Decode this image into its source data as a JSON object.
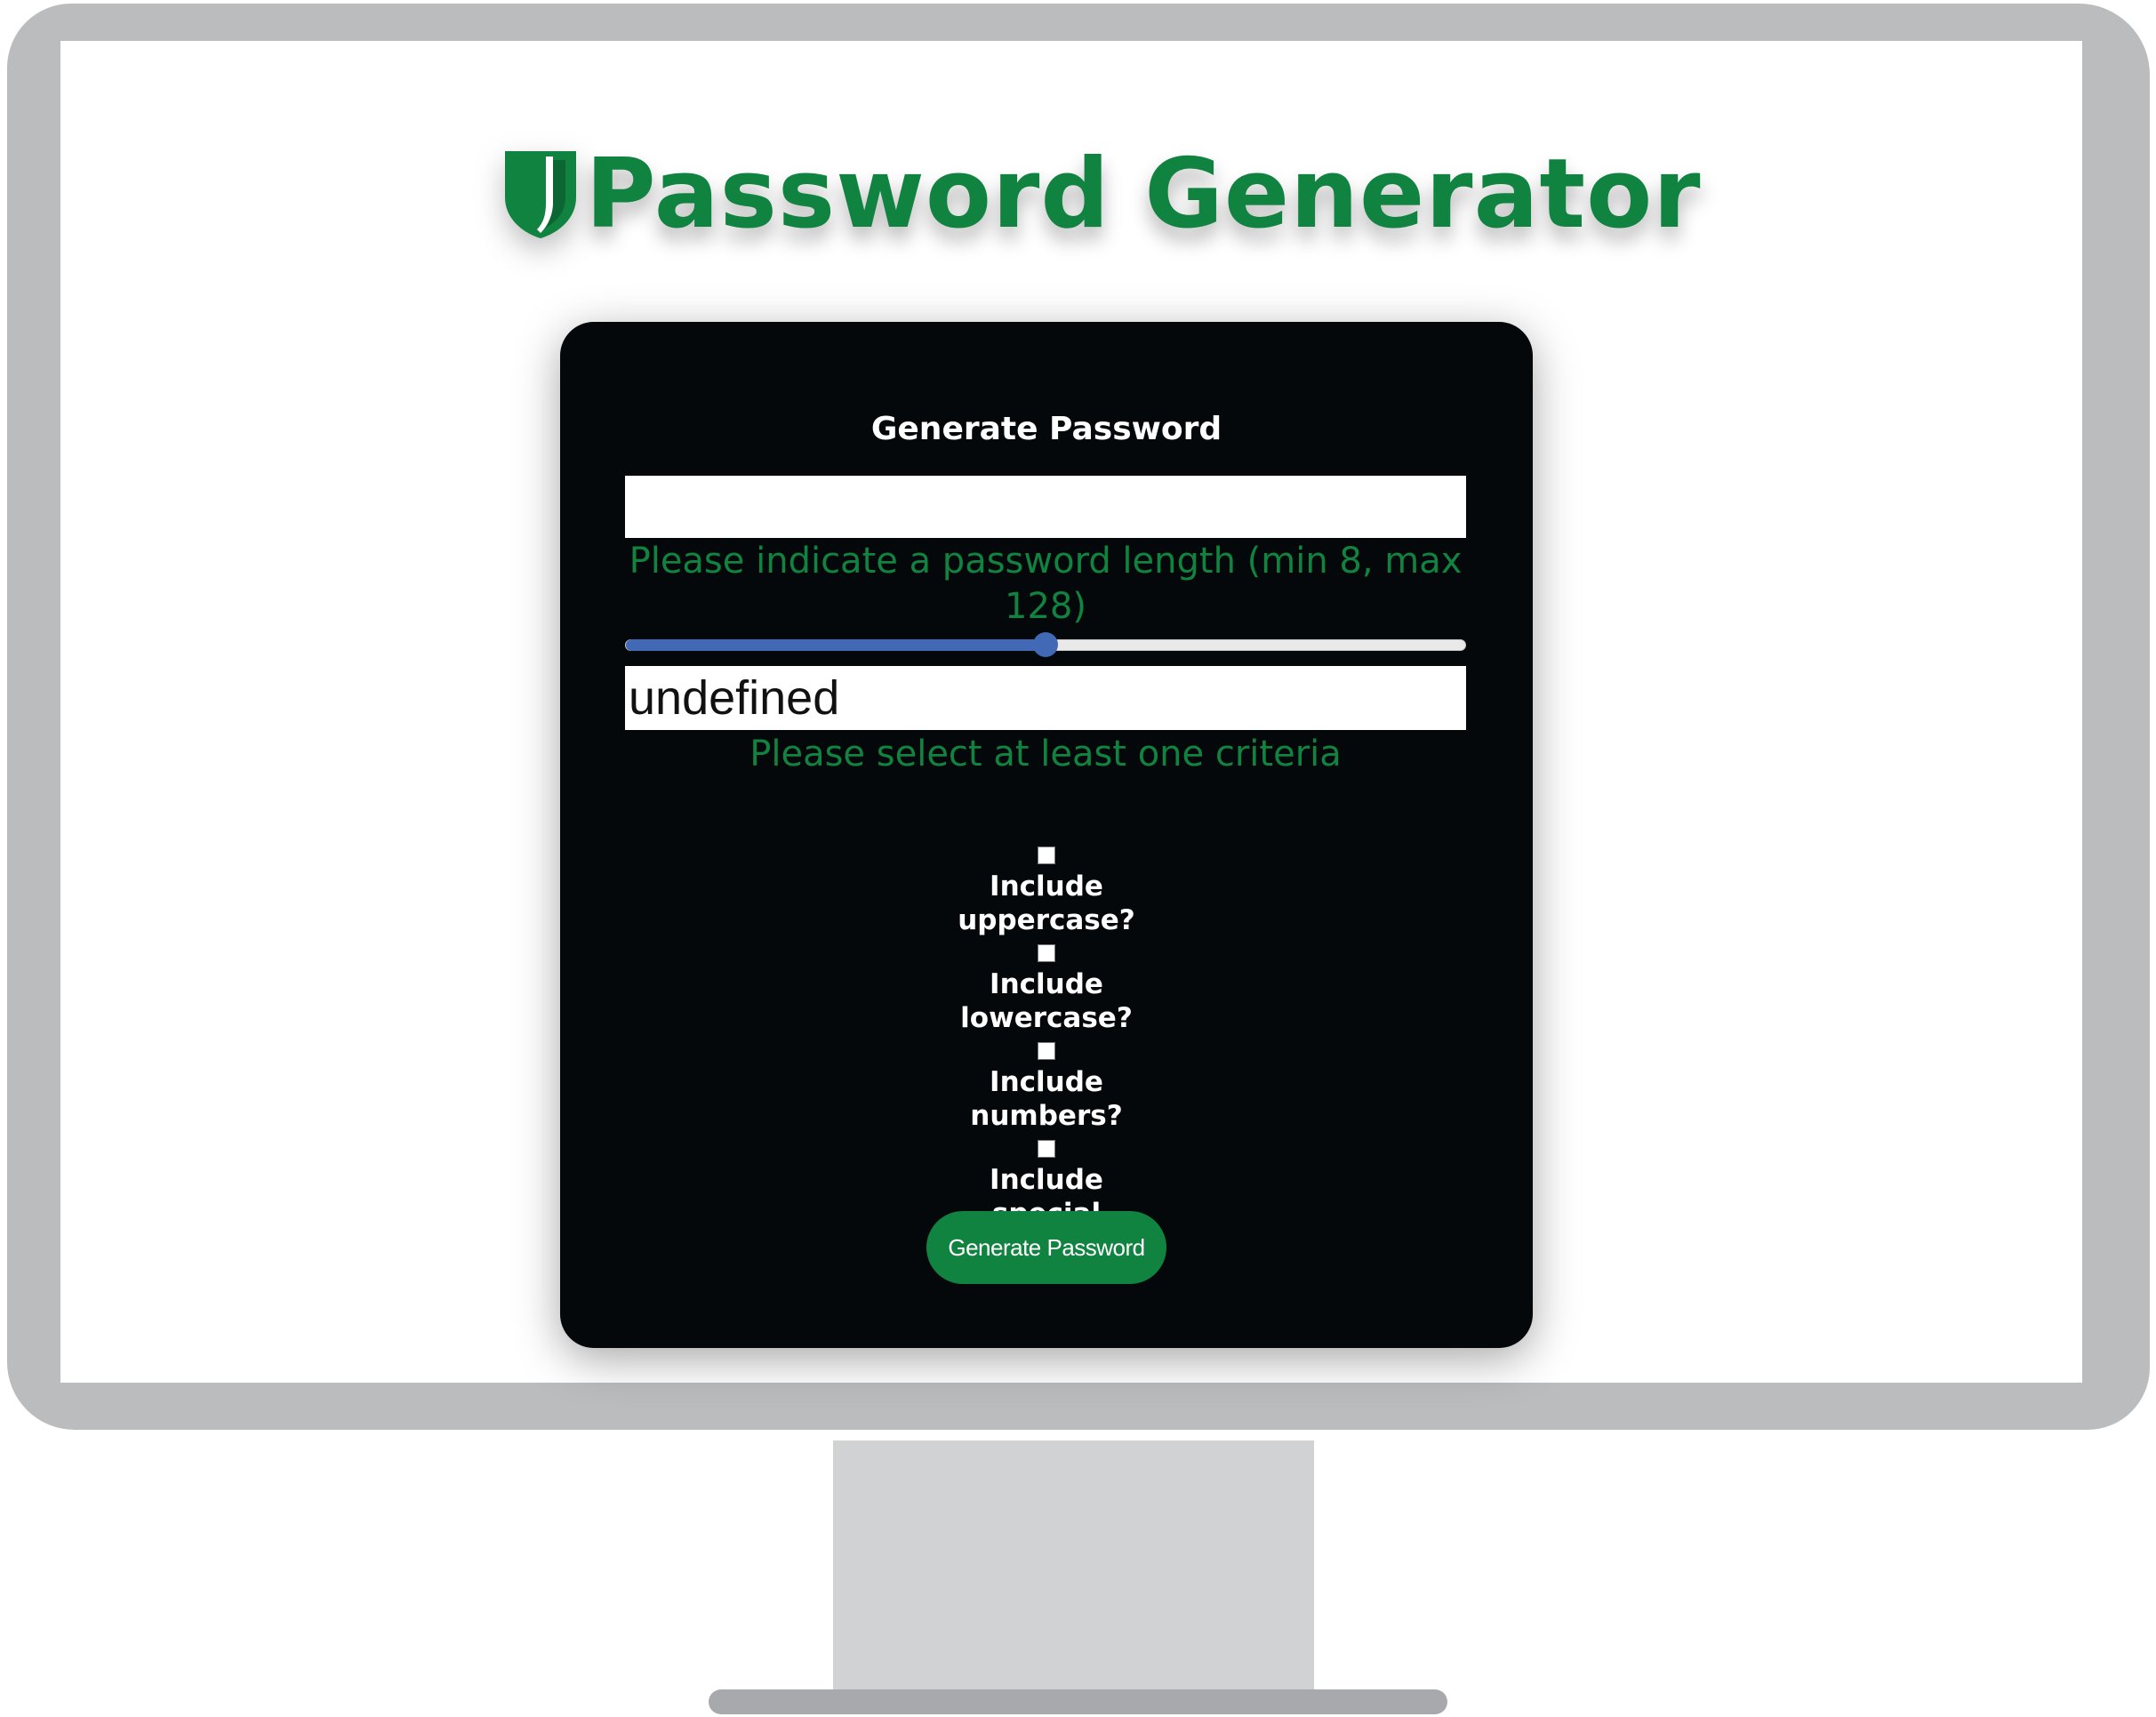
{
  "header": {
    "title": "Password Generator",
    "logo_icon": "shield-icon"
  },
  "card": {
    "title": "Generate Password",
    "password_output": "",
    "length_hint": "Please indicate a password length (min 8, max 128)",
    "length_slider": {
      "min": 8,
      "max": 128,
      "fill_fraction": 0.5
    },
    "length_value": "undefined",
    "criteria_hint": "Please select at least one criteria",
    "criteria": [
      {
        "label": "Include uppercase?",
        "checked": false
      },
      {
        "label": "Include lowercase?",
        "checked": false
      },
      {
        "label": "Include numbers?",
        "checked": false
      },
      {
        "label": "Include special characters?",
        "checked": false
      }
    ],
    "generate_button_label": "Generate Password"
  },
  "colors": {
    "brand_green": "#118340",
    "card_bg": "#04080a",
    "slider_blue": "#4169b6",
    "monitor_gray": "#bbbcbe"
  }
}
